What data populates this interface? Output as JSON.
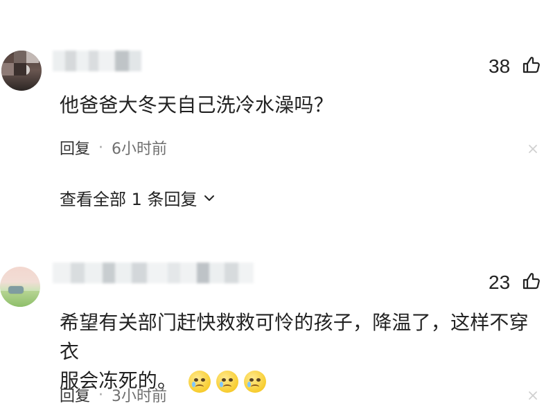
{
  "comments": [
    {
      "likes": "38",
      "text": "他爸爸大冬天自己洗冷水澡吗？",
      "reply_label": "回复",
      "separator": "·",
      "time": "6小时前",
      "view_all": "查看全部 1 条回复"
    },
    {
      "likes": "23",
      "text_line_1": "希望有关部门赶快救救可怜的孩子，降温了，这样不穿衣",
      "text_line_2": "服会冻死的。",
      "reply_label": "回复",
      "separator": "·",
      "time": "3小时前"
    }
  ],
  "icons": {
    "like": "thumbs-up-icon",
    "close": "close-icon",
    "chevron": "chevron-down-icon",
    "emoji": "crying-face-icon"
  },
  "colors": {
    "text": "#222222",
    "meta": "#6f6f6f",
    "icon_gray": "#d0d0d0"
  }
}
